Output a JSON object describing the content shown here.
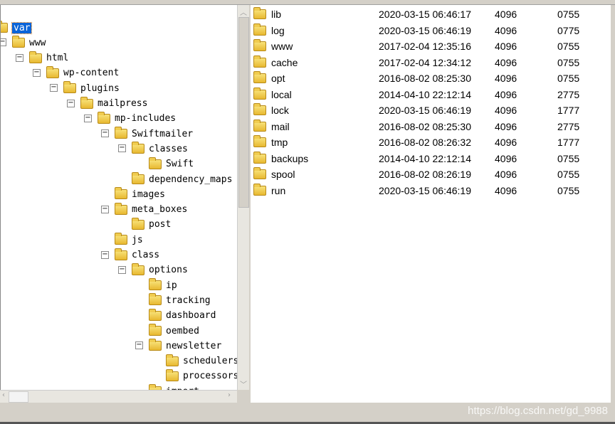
{
  "tree": [
    {
      "label": "var",
      "level": 0,
      "selected": true,
      "toggle": false
    },
    {
      "label": "www",
      "level": 1,
      "toggle": true
    },
    {
      "label": "html",
      "level": 2,
      "toggle": true
    },
    {
      "label": "wp-content",
      "level": 3,
      "toggle": true
    },
    {
      "label": "plugins",
      "level": 4,
      "toggle": true
    },
    {
      "label": "mailpress",
      "level": 5,
      "toggle": true
    },
    {
      "label": "mp-includes",
      "level": 6,
      "toggle": true
    },
    {
      "label": "Swiftmailer",
      "level": 7,
      "toggle": true
    },
    {
      "label": "classes",
      "level": 8,
      "toggle": true
    },
    {
      "label": "Swift",
      "level": 9,
      "toggle": false
    },
    {
      "label": "dependency_maps",
      "level": 8,
      "toggle": false
    },
    {
      "label": "images",
      "level": 7,
      "toggle": false
    },
    {
      "label": "meta_boxes",
      "level": 7,
      "toggle": true
    },
    {
      "label": "post",
      "level": 8,
      "toggle": false
    },
    {
      "label": "js",
      "level": 7,
      "toggle": false
    },
    {
      "label": "class",
      "level": 7,
      "toggle": true
    },
    {
      "label": "options",
      "level": 8,
      "toggle": true
    },
    {
      "label": "ip",
      "level": 9,
      "toggle": false
    },
    {
      "label": "tracking",
      "level": 9,
      "toggle": false
    },
    {
      "label": "dashboard",
      "level": 9,
      "toggle": false
    },
    {
      "label": "oembed",
      "level": 9,
      "toggle": false
    },
    {
      "label": "newsletter",
      "level": 9,
      "toggle": true
    },
    {
      "label": "schedulers",
      "level": 10,
      "toggle": false
    },
    {
      "label": "processors",
      "level": 10,
      "toggle": false
    },
    {
      "label": "import",
      "level": 9,
      "toggle": false
    }
  ],
  "toggle_symbol": "−",
  "files": [
    {
      "name": "lib",
      "date": "2020-03-15 06:46:17",
      "size": "4096",
      "perms": "0755"
    },
    {
      "name": "log",
      "date": "2020-03-15 06:46:19",
      "size": "4096",
      "perms": "0775"
    },
    {
      "name": "www",
      "date": "2017-02-04 12:35:16",
      "size": "4096",
      "perms": "0755"
    },
    {
      "name": "cache",
      "date": "2017-02-04 12:34:12",
      "size": "4096",
      "perms": "0755"
    },
    {
      "name": "opt",
      "date": "2016-08-02 08:25:30",
      "size": "4096",
      "perms": "0755"
    },
    {
      "name": "local",
      "date": "2014-04-10 22:12:14",
      "size": "4096",
      "perms": "2775"
    },
    {
      "name": "lock",
      "date": "2020-03-15 06:46:19",
      "size": "4096",
      "perms": "1777"
    },
    {
      "name": "mail",
      "date": "2016-08-02 08:25:30",
      "size": "4096",
      "perms": "2775"
    },
    {
      "name": "tmp",
      "date": "2016-08-02 08:26:32",
      "size": "4096",
      "perms": "1777"
    },
    {
      "name": "backups",
      "date": "2014-04-10 22:12:14",
      "size": "4096",
      "perms": "0755"
    },
    {
      "name": "spool",
      "date": "2016-08-02 08:26:19",
      "size": "4096",
      "perms": "0755"
    },
    {
      "name": "run",
      "date": "2020-03-15 06:46:19",
      "size": "4096",
      "perms": "0755"
    }
  ],
  "watermark": "https://blog.csdn.net/gd_9988",
  "scroll": {
    "up": "︿",
    "down": "﹀",
    "left": "‹",
    "right": "›"
  }
}
